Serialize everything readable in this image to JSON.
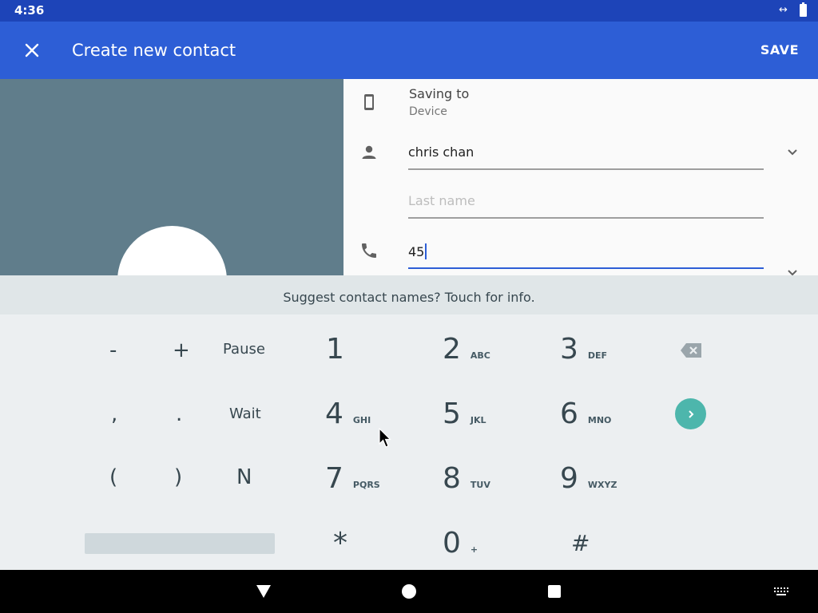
{
  "status_bar": {
    "time": "4:36",
    "icons": [
      "data-swap-icon",
      "battery-icon"
    ],
    "color": "#1d44b8"
  },
  "app_bar": {
    "close_icon": "close-icon",
    "title": "Create new contact",
    "save_label": "SAVE",
    "color": "#2d5ed6"
  },
  "photo": {
    "background": "#607d8b"
  },
  "form": {
    "saving_label": "Saving to",
    "saving_value": "Device",
    "first_name_value": "chris chan",
    "last_name_placeholder": "Last name",
    "phone_value": "45"
  },
  "suggestion": {
    "text": "Suggest contact names? Touch for info."
  },
  "keypad": {
    "symbols": {
      "minus": "-",
      "plus": "+",
      "pause": "Pause",
      "comma": ",",
      "period": ".",
      "wait": "Wait",
      "lparen": "(",
      "rparen": ")",
      "n": "N"
    },
    "digits": [
      {
        "num": "1",
        "letters": ""
      },
      {
        "num": "2",
        "letters": "ABC"
      },
      {
        "num": "3",
        "letters": "DEF"
      },
      {
        "num": "4",
        "letters": "GHI"
      },
      {
        "num": "5",
        "letters": "JKL"
      },
      {
        "num": "6",
        "letters": "MNO"
      },
      {
        "num": "7",
        "letters": "PQRS"
      },
      {
        "num": "8",
        "letters": "TUV"
      },
      {
        "num": "9",
        "letters": "WXYZ"
      },
      {
        "num": "*",
        "letters": ""
      },
      {
        "num": "0",
        "letters": "+"
      },
      {
        "num": "#",
        "letters": ""
      }
    ],
    "accent": "#4db6ac"
  },
  "nav_bar": {
    "icons": [
      "back-icon",
      "home-icon",
      "recents-icon",
      "keyboard-icon"
    ]
  }
}
